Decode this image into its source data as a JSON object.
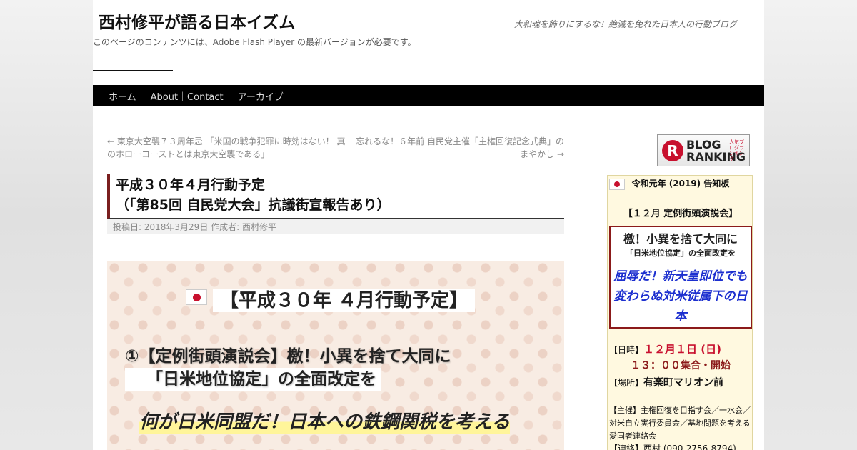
{
  "header": {
    "site_title": "西村修平が語る日本イズム",
    "site_description": "大和魂を飾りにするな！絶滅を免れた日本人の行動ブログ",
    "flash_notice": "このページのコンテンツには、Adobe Flash Player の最新バージョンが必要です。"
  },
  "nav": {
    "items": [
      "ホーム",
      "About｜Contact",
      "アーカイブ"
    ]
  },
  "post_nav": {
    "prev": "← 東京大空襲７３周年忌 「米国の戦争犯罪に時効はない！ 真のホローコーストとは東京大空襲である」",
    "next": "忘れるな！６年前 自民党主催「主権回復記念式典」のまやかし →"
  },
  "entry": {
    "title_line1": "平成３０年４月行動予定",
    "title_line2": "（「第85回 自民党大会」抗議街宣報告あり）",
    "meta_posted": "投稿日:",
    "meta_date": "2018年3月29日",
    "meta_author_label": "作成者:",
    "meta_author": "西村修平"
  },
  "post_body": {
    "heading": "【平成３０年 ４月行動予定】",
    "item1_line1": "①【定例街頭演説会】檄！小異を捨て大同に",
    "item1_line2": "「日米地位協定」の全面改定を",
    "highlight": "何が日米同盟だ！日本への鉄鋼関税を考える"
  },
  "sidebar": {
    "ranking": {
      "badge": "R",
      "line1": "BLOG",
      "line2": "RANKING",
      "small": "人気ブログランキング"
    },
    "widget": {
      "title": "令和元年 (2019) 告知板",
      "subtitle": "【１２月 定例街頭演説会】",
      "theme1": "檄！小異を捨て大同に",
      "theme2": "「日米地位協定」の全面改定を",
      "blue_text": "屈辱だ！新天皇即位でも変わらぬ対米従属下の日本",
      "date_label": "【日時】",
      "date_value": "１２月１日 (日)",
      "time_value": "１３：００集合・開始",
      "place_label": "【場所】",
      "place_value": "有楽町マリオン前",
      "host": "【主催】主権回復を目指す会／一水会／対米自立実行委員会／基地問題を考える愛国者連絡会",
      "contact": "【連絡】西村 (090-2756-8794)"
    }
  },
  "colors": {
    "nav_bg": "#000000",
    "accent_red": "#c8102e",
    "title_border": "#7a1f1f",
    "blue_text": "#1c2fcf",
    "widget_bg": "#fff9e0"
  }
}
